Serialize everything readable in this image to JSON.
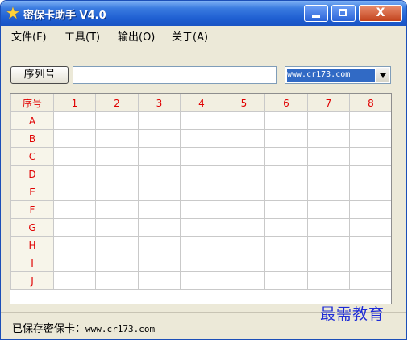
{
  "window": {
    "title": "密保卡助手 V4.0",
    "min_label": "",
    "max_label": "",
    "close_label": "X"
  },
  "menu": [
    "文件(F)",
    "工具(T)",
    "输出(O)",
    "关于(A)"
  ],
  "toolbar": {
    "serial_button": "序列号",
    "serial_value": "",
    "site_selected": "www.cr173.com"
  },
  "grid": {
    "corner": "序号",
    "columns": [
      "1",
      "2",
      "3",
      "4",
      "5",
      "6",
      "7",
      "8"
    ],
    "rows": [
      "A",
      "B",
      "C",
      "D",
      "E",
      "F",
      "G",
      "H",
      "I",
      "J"
    ],
    "cells": [
      [
        "",
        "",
        "",
        "",
        "",
        "",
        "",
        ""
      ],
      [
        "",
        "",
        "",
        "",
        "",
        "",
        "",
        ""
      ],
      [
        "",
        "",
        "",
        "",
        "",
        "",
        "",
        ""
      ],
      [
        "",
        "",
        "",
        "",
        "",
        "",
        "",
        ""
      ],
      [
        "",
        "",
        "",
        "",
        "",
        "",
        "",
        ""
      ],
      [
        "",
        "",
        "",
        "",
        "",
        "",
        "",
        ""
      ],
      [
        "",
        "",
        "",
        "",
        "",
        "",
        "",
        ""
      ],
      [
        "",
        "",
        "",
        "",
        "",
        "",
        "",
        ""
      ],
      [
        "",
        "",
        "",
        "",
        "",
        "",
        "",
        ""
      ],
      [
        "",
        "",
        "",
        "",
        "",
        "",
        "",
        ""
      ]
    ]
  },
  "status": {
    "label": "已保存密保卡：",
    "value": "www.cr173.com"
  },
  "watermark": "最需教育",
  "colors": {
    "header_text": "#e00000",
    "title_bar": "#1f5fd2",
    "selection": "#316ac5",
    "watermark": "#1d2bd6"
  },
  "icons": {
    "app": "star-icon",
    "minimize": "minimize-icon",
    "maximize": "maximize-icon",
    "close": "close-icon",
    "dropdown": "chevron-down-icon"
  }
}
